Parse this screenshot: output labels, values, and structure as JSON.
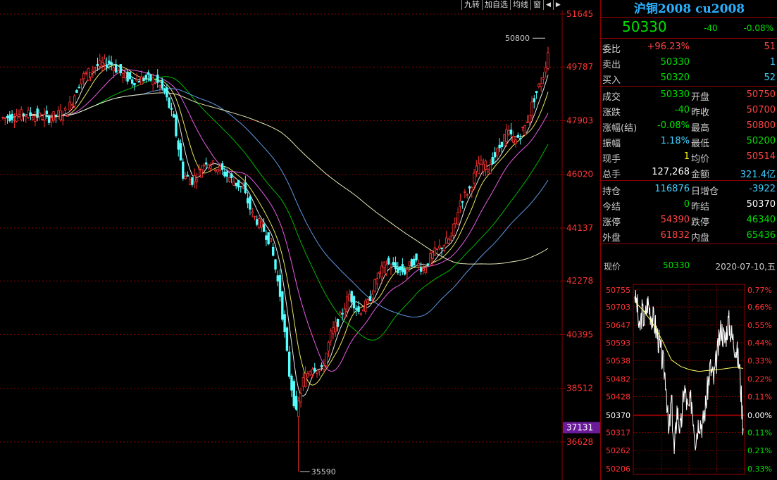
{
  "toolbar": {
    "items": [
      "九转",
      "加自选",
      "均线",
      "窗"
    ]
  },
  "contract": {
    "title": "沪铜2008 cu2008"
  },
  "quote": {
    "price": "50330",
    "change": "-40",
    "change_pct": "-0.08%"
  },
  "rows": [
    {
      "l1": "委比",
      "v1": "+96.23%",
      "c1": "red",
      "l2": "",
      "v2": "51",
      "c2": "red"
    },
    {
      "l1": "卖出",
      "v1": "50330",
      "c1": "green",
      "l2": "",
      "v2": "1",
      "c2": "cyan"
    },
    {
      "l1": "买入",
      "v1": "50320",
      "c1": "green",
      "l2": "",
      "v2": "52",
      "c2": "cyan"
    },
    {
      "l1": "成交",
      "v1": "50330",
      "c1": "green",
      "l2": "开盘",
      "v2": "50750",
      "c2": "red"
    },
    {
      "l1": "涨跌",
      "v1": "-40",
      "c1": "green",
      "l2": "昨收",
      "v2": "50700",
      "c2": "red"
    },
    {
      "l1": "涨幅(结)",
      "v1": "-0.08%",
      "c1": "green",
      "l2": "最高",
      "v2": "50800",
      "c2": "red"
    },
    {
      "l1": "振幅",
      "v1": "1.18%",
      "c1": "cyan",
      "l2": "最低",
      "v2": "50200",
      "c2": "green"
    },
    {
      "l1": "现手",
      "v1": "1",
      "c1": "yellow",
      "l2": "均价",
      "v2": "50514",
      "c2": "red"
    },
    {
      "l1": "总手",
      "v1": "127,268",
      "c1": "white",
      "l2": "金额",
      "v2": "321.4亿",
      "c2": "cyan"
    },
    {
      "l1": "持仓",
      "v1": "116876",
      "c1": "cyan",
      "l2": "日增仓",
      "v2": "-3922",
      "c2": "cyan"
    },
    {
      "l1": "今结",
      "v1": "0",
      "c1": "green",
      "l2": "昨结",
      "v2": "50370",
      "c2": "white"
    },
    {
      "l1": "涨停",
      "v1": "54390",
      "c1": "red",
      "l2": "跌停",
      "v2": "46340",
      "c2": "green"
    },
    {
      "l1": "外盘",
      "v1": "61832",
      "c1": "red",
      "l2": "内盘",
      "v2": "65436",
      "c2": "green"
    }
  ],
  "ticker": {
    "label": "现价",
    "price": "50330",
    "date": "2020-07-10,五"
  },
  "colors": {
    "up": "#ff3333",
    "down": "#54ffff",
    "grid": "#8b0000",
    "axis": "#ff3333",
    "highlight": "#6a1b9a"
  },
  "chart_data": [
    {
      "type": "candlestick",
      "title": "",
      "y_ticks": [
        51645,
        49787,
        47903,
        46020,
        44137,
        42278,
        40395,
        38512,
        36628
      ],
      "ylim": [
        35590,
        51645
      ],
      "current_marker": "37131",
      "annotations": [
        {
          "text": "50800",
          "label": "high"
        },
        {
          "text": "35590",
          "label": "low"
        }
      ],
      "close_path": [
        [
          0,
          48000
        ],
        [
          10,
          48150
        ],
        [
          20,
          48000
        ],
        [
          28,
          48250
        ],
        [
          34,
          49400
        ],
        [
          40,
          49800
        ],
        [
          46,
          49950
        ],
        [
          52,
          49500
        ],
        [
          56,
          49300
        ],
        [
          62,
          49400
        ],
        [
          66,
          49300
        ],
        [
          70,
          48900
        ],
        [
          74,
          47900
        ],
        [
          78,
          46000
        ],
        [
          82,
          45800
        ],
        [
          88,
          46500
        ],
        [
          94,
          46200
        ],
        [
          98,
          45900
        ],
        [
          104,
          45500
        ],
        [
          108,
          44600
        ],
        [
          112,
          44200
        ],
        [
          116,
          43600
        ],
        [
          120,
          41800
        ],
        [
          124,
          39000
        ],
        [
          127,
          37600
        ],
        [
          130,
          38800
        ],
        [
          134,
          39300
        ],
        [
          138,
          39100
        ],
        [
          142,
          40400
        ],
        [
          146,
          41000
        ],
        [
          150,
          41800
        ],
        [
          154,
          41200
        ],
        [
          158,
          41500
        ],
        [
          162,
          42400
        ],
        [
          166,
          42900
        ],
        [
          170,
          42700
        ],
        [
          174,
          42600
        ],
        [
          178,
          43000
        ],
        [
          182,
          42700
        ],
        [
          186,
          43200
        ],
        [
          190,
          43500
        ],
        [
          194,
          43800
        ],
        [
          198,
          45100
        ],
        [
          202,
          45500
        ],
        [
          206,
          46400
        ],
        [
          210,
          46300
        ],
        [
          214,
          46800
        ],
        [
          218,
          47500
        ],
        [
          222,
          47200
        ],
        [
          226,
          47700
        ],
        [
          230,
          48700
        ],
        [
          234,
          49500
        ],
        [
          236,
          50330
        ]
      ],
      "ma_lines": [
        {
          "color": "#ffffff",
          "lag": 5
        },
        {
          "color": "#ffff66",
          "lag": 10
        },
        {
          "color": "#ff66ff",
          "lag": 20
        },
        {
          "color": "#00cc00",
          "lag": 40
        },
        {
          "color": "#66aaff",
          "lag": 60
        },
        {
          "color": "#ffffcc",
          "lag": 120
        }
      ]
    },
    {
      "type": "line",
      "title": "",
      "left_ticks": [
        50755,
        50703,
        50647,
        50593,
        50538,
        50482,
        50428,
        50370,
        50317,
        50262,
        50206
      ],
      "right_ticks": [
        "0.77%",
        "0.66%",
        "0.55%",
        "0.44%",
        "0.33%",
        "0.22%",
        "0.11%",
        "0.00%",
        "0.11%",
        "0.21%",
        "0.33%"
      ],
      "ylim": [
        50206,
        50755
      ],
      "baseline": 50370,
      "price": [
        [
          0,
          50750
        ],
        [
          3,
          50700
        ],
        [
          5,
          50620
        ],
        [
          8,
          50690
        ],
        [
          11,
          50660
        ],
        [
          14,
          50720
        ],
        [
          18,
          50680
        ],
        [
          22,
          50650
        ],
        [
          26,
          50600
        ],
        [
          30,
          50540
        ],
        [
          34,
          50480
        ],
        [
          37,
          50300
        ],
        [
          40,
          50420
        ],
        [
          43,
          50250
        ],
        [
          46,
          50390
        ],
        [
          50,
          50320
        ],
        [
          54,
          50460
        ],
        [
          58,
          50380
        ],
        [
          62,
          50420
        ],
        [
          66,
          50300
        ],
        [
          70,
          50360
        ],
        [
          74,
          50340
        ],
        [
          78,
          50420
        ],
        [
          82,
          50520
        ],
        [
          86,
          50480
        ],
        [
          90,
          50560
        ],
        [
          94,
          50640
        ],
        [
          98,
          50600
        ],
        [
          102,
          50660
        ],
        [
          106,
          50610
        ],
        [
          110,
          50580
        ],
        [
          114,
          50520
        ],
        [
          118,
          50330
        ]
      ],
      "avg": [
        [
          0,
          50720
        ],
        [
          10,
          50690
        ],
        [
          20,
          50650
        ],
        [
          30,
          50600
        ],
        [
          40,
          50540
        ],
        [
          50,
          50520
        ],
        [
          60,
          50510
        ],
        [
          70,
          50505
        ],
        [
          80,
          50508
        ],
        [
          90,
          50510
        ],
        [
          100,
          50514
        ],
        [
          110,
          50518
        ],
        [
          118,
          50514
        ]
      ]
    }
  ]
}
